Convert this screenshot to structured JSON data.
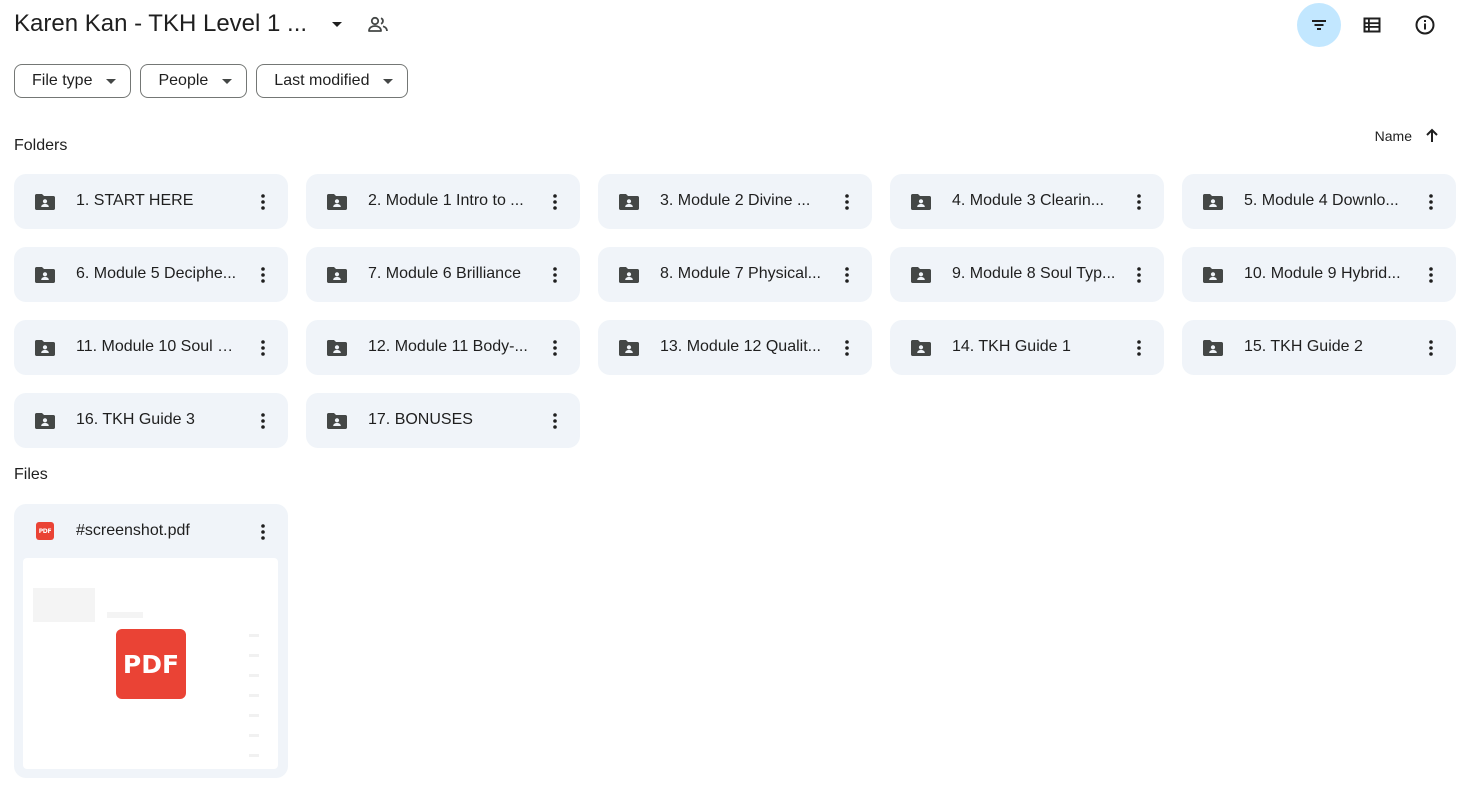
{
  "header": {
    "title": "Karen Kan - TKH Level 1 ...",
    "icons": [
      "dropdown-arrow-icon",
      "shared-people-icon",
      "filter-icon",
      "list-view-icon",
      "info-icon"
    ]
  },
  "filters": [
    "File type",
    "People",
    "Last modified"
  ],
  "sections": {
    "folders_label": "Folders",
    "files_label": "Files"
  },
  "sort": {
    "label": "Name",
    "direction_icon": "arrow-up-icon"
  },
  "folders": [
    "1. START HERE",
    "2. Module 1 Intro to ...",
    "3. Module 2 Divine ...",
    "4. Module 3 Clearin...",
    "5. Module 4 Downlo...",
    "6. Module 5 Deciphe...",
    "7. Module 6 Brilliance",
    "8. Module 7 Physical...",
    "9. Module 8 Soul Typ...",
    "10. Module 9 Hybrid...",
    "11. Module 10 Soul M...",
    "12. Module 11 Body-...",
    "13. Module 12 Qualit...",
    "14. TKH Guide 1",
    "15. TKH Guide 2",
    "16. TKH Guide 3",
    "17. BONUSES"
  ],
  "files": [
    {
      "name": "#screenshot.pdf",
      "badge": "PDF",
      "thumb_label": "PDF"
    }
  ],
  "colors": {
    "card_bg": "#f0f4f9",
    "active_filter_bg": "#c2e7ff",
    "pdf_red": "#ea4335",
    "icon_gray": "#444746"
  }
}
